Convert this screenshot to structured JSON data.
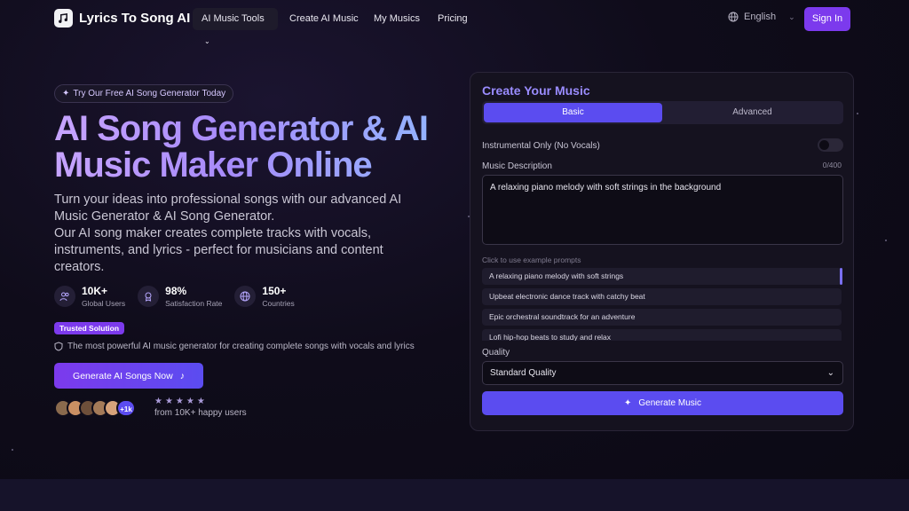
{
  "nav": {
    "brand": "Lyrics To Song AI",
    "items": [
      {
        "label": "AI Music Tools"
      },
      {
        "label": "Create AI Music"
      },
      {
        "label": "My Musics"
      },
      {
        "label": "Pricing"
      }
    ],
    "language": "English",
    "signin": "Sign In"
  },
  "hero": {
    "badge": "Try Our Free AI Song Generator Today",
    "title": "AI Song Generator & AI Music Maker Online",
    "description_1": "Turn your ideas into professional songs with our advanced AI Music Generator & AI Song Generator.",
    "description_2": "Our AI song maker creates complete tracks with vocals, instruments, and lyrics - perfect for musicians and content creators.",
    "stats": [
      {
        "value": "10K+",
        "label": "Global Users",
        "icon": "users-icon"
      },
      {
        "value": "98%",
        "label": "Satisfaction Rate",
        "icon": "award-icon"
      },
      {
        "value": "150+",
        "label": "Countries",
        "icon": "globe-icon"
      }
    ],
    "trusted": "Trusted Solution",
    "powerful": "The most powerful AI music generator for creating complete songs with vocals and lyrics",
    "cta": "Generate AI Songs Now",
    "avatars_more": "+1k",
    "stars": "★★★★★",
    "happy_users": "from 10K+ happy users"
  },
  "panel": {
    "title": "Create Your Music",
    "tabs": [
      {
        "label": "Basic",
        "active": true
      },
      {
        "label": "Advanced",
        "active": false
      }
    ],
    "instrumental_label": "Instrumental Only (No Vocals)",
    "instrumental_on": false,
    "description_label": "Music Description",
    "char_count": "0/400",
    "description_value": "A relaxing piano melody with soft strings in the background",
    "examples_label": "Click to use example prompts",
    "examples": [
      "A relaxing piano melody with soft strings",
      "Upbeat electronic dance track with catchy beat",
      "Epic orchestral soundtrack for an adventure",
      "Lofi hip-hop beats to study and relax"
    ],
    "quality_label": "Quality",
    "quality_value": "Standard Quality",
    "generate": "Generate Music"
  },
  "colors": {
    "accent": "#7c3aed",
    "button": "#5b4cf0",
    "title": "#9a8cff"
  }
}
